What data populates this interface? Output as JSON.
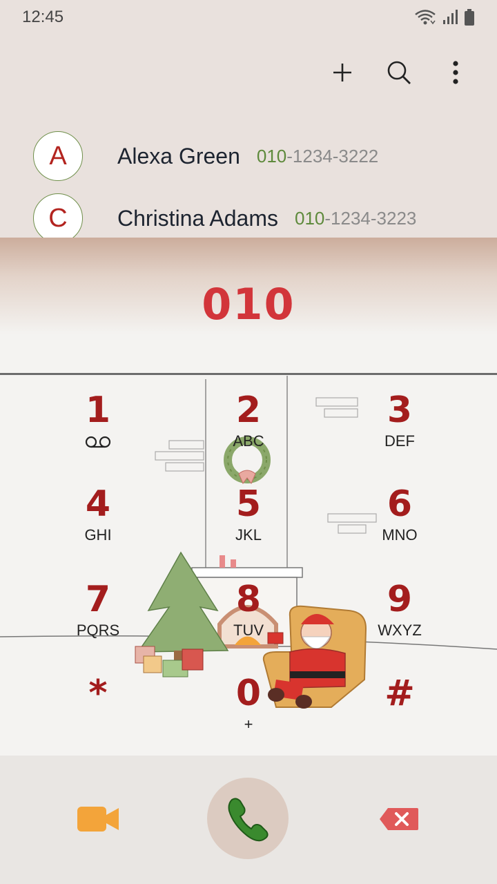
{
  "status": {
    "time": "12:45"
  },
  "toolbar": {
    "add_icon": "plus-icon",
    "search_icon": "search-icon",
    "more_icon": "more-vert-icon"
  },
  "contacts": [
    {
      "initial": "A",
      "name": "Alexa Green",
      "number_match": "010",
      "number_rest": "-1234-3222"
    },
    {
      "initial": "C",
      "name": "Christina Adams",
      "number_match": "010",
      "number_rest": "-1234-3223"
    }
  ],
  "dialer": {
    "entered_number": "010"
  },
  "keypad": [
    {
      "digit": "1",
      "letters": ""
    },
    {
      "digit": "2",
      "letters": "ABC"
    },
    {
      "digit": "3",
      "letters": "DEF"
    },
    {
      "digit": "4",
      "letters": "GHI"
    },
    {
      "digit": "5",
      "letters": "JKL"
    },
    {
      "digit": "6",
      "letters": "MNO"
    },
    {
      "digit": "7",
      "letters": "PQRS"
    },
    {
      "digit": "8",
      "letters": "TUV"
    },
    {
      "digit": "9",
      "letters": "WXYZ"
    },
    {
      "digit": "*",
      "letters": ""
    },
    {
      "digit": "0",
      "letters": "+"
    },
    {
      "digit": "#",
      "letters": ""
    }
  ],
  "bottom": {
    "video_icon": "video-call-icon",
    "call_icon": "phone-icon",
    "delete_icon": "backspace-icon"
  },
  "colors": {
    "accent": "#a31d1d",
    "number": "#d2353a",
    "match": "#5e8a3c",
    "video": "#f3a43a",
    "call": "#3a8a2e",
    "delete": "#e05a5a"
  }
}
